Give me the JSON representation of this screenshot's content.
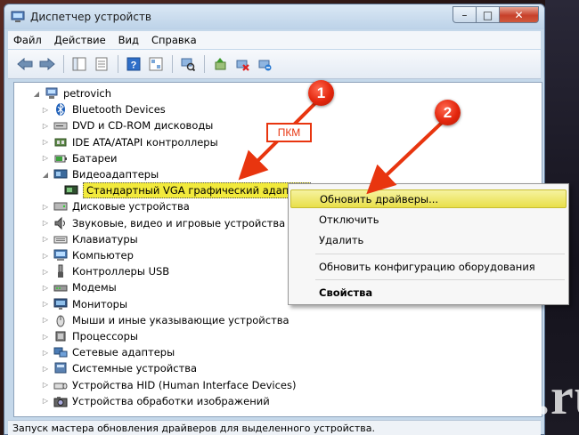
{
  "window": {
    "title": "Диспетчер устройств",
    "buttons": {
      "minimize": "–",
      "maximize": "□",
      "close": "✕"
    }
  },
  "menu": [
    {
      "label": "Файл"
    },
    {
      "label": "Действие"
    },
    {
      "label": "Вид"
    },
    {
      "label": "Справка"
    }
  ],
  "toolbar": {
    "icons": [
      "back-icon",
      "forward-icon",
      "console-tree-icon",
      "properties-icon",
      "help-icon",
      "show-hidden-icon",
      "scan-hardware-icon",
      "update-driver-icon",
      "disable-device-icon",
      "uninstall-device-icon"
    ]
  },
  "tree": {
    "root": "petrovich",
    "items": [
      {
        "label": "Bluetooth Devices",
        "icon": "bluetooth-icon",
        "expanded": false
      },
      {
        "label": "DVD и CD-ROM дисководы",
        "icon": "dvd-drive-icon",
        "expanded": false
      },
      {
        "label": "IDE ATA/ATAPI контроллеры",
        "icon": "ide-controller-icon",
        "expanded": false
      },
      {
        "label": "Батареи",
        "icon": "battery-icon",
        "expanded": false
      },
      {
        "label": "Видеоадаптеры",
        "icon": "display-adapter-icon",
        "expanded": true
      },
      {
        "label": "Стандартный VGA графический адаптер",
        "icon": "vga-adapter-icon",
        "child": true,
        "selected": true
      },
      {
        "label": "Дисковые устройства",
        "icon": "disk-drive-icon",
        "expanded": false
      },
      {
        "label": "Звуковые, видео и игровые устройства",
        "icon": "sound-icon",
        "expanded": false
      },
      {
        "label": "Клавиатуры",
        "icon": "keyboard-icon",
        "expanded": false
      },
      {
        "label": "Компьютер",
        "icon": "computer-icon",
        "expanded": false
      },
      {
        "label": "Контроллеры USB",
        "icon": "usb-icon",
        "expanded": false
      },
      {
        "label": "Модемы",
        "icon": "modem-icon",
        "expanded": false
      },
      {
        "label": "Мониторы",
        "icon": "monitor-icon",
        "expanded": false
      },
      {
        "label": "Мыши и иные указывающие устройства",
        "icon": "mouse-icon",
        "expanded": false
      },
      {
        "label": "Процессоры",
        "icon": "processor-icon",
        "expanded": false
      },
      {
        "label": "Сетевые адаптеры",
        "icon": "network-adapter-icon",
        "expanded": false
      },
      {
        "label": "Системные устройства",
        "icon": "system-devices-icon",
        "expanded": false
      },
      {
        "label": "Устройства HID (Human Interface Devices)",
        "icon": "hid-icon",
        "expanded": false
      },
      {
        "label": "Устройства обработки изображений",
        "icon": "imaging-icon",
        "expanded": false
      }
    ]
  },
  "context_menu": {
    "items": [
      {
        "label": "Обновить драйверы...",
        "highlighted": true
      },
      {
        "label": "Отключить"
      },
      {
        "label": "Удалить"
      },
      {
        "label": "Обновить конфигурацию оборудования"
      },
      {
        "label": "Свойства",
        "bold": true
      }
    ]
  },
  "annotations": {
    "badge1": "1",
    "badge2": "2",
    "callout": "ПКМ",
    "color": "#e8350f"
  },
  "status": "Запуск мастера обновления драйверов для выделенного устройства.",
  "watermark": "Postila.ru"
}
